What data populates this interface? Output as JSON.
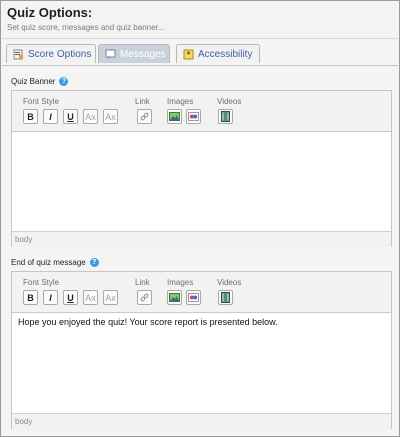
{
  "header": {
    "title": "Quiz Options:",
    "subtitle": "Set quiz score, messages and quiz banner..."
  },
  "tabs": [
    {
      "label": "Score Options",
      "icon": "score-options-icon",
      "active": false
    },
    {
      "label": "Messages",
      "icon": "messages-icon",
      "active": true
    },
    {
      "label": "Accessibility",
      "icon": "accessibility-icon",
      "active": false
    }
  ],
  "toolbar_labels": {
    "font_style": "Font Style",
    "link": "Link",
    "images": "Images",
    "videos": "Videos",
    "bold": "B",
    "italic": "I",
    "underline": "U",
    "subscript": "Ax",
    "superscript": "Ax"
  },
  "banner_editor": {
    "label": "Quiz Banner",
    "content": "",
    "status": "body"
  },
  "end_message_editor": {
    "label": "End of quiz message",
    "content": "Hope you enjoyed the quiz! Your score report is presented below.",
    "status": "body"
  },
  "colors": {
    "accent_blue": "#3c5fa8",
    "help_blue": "#3a9be0",
    "active_tab_bg": "#c9d2dc"
  }
}
